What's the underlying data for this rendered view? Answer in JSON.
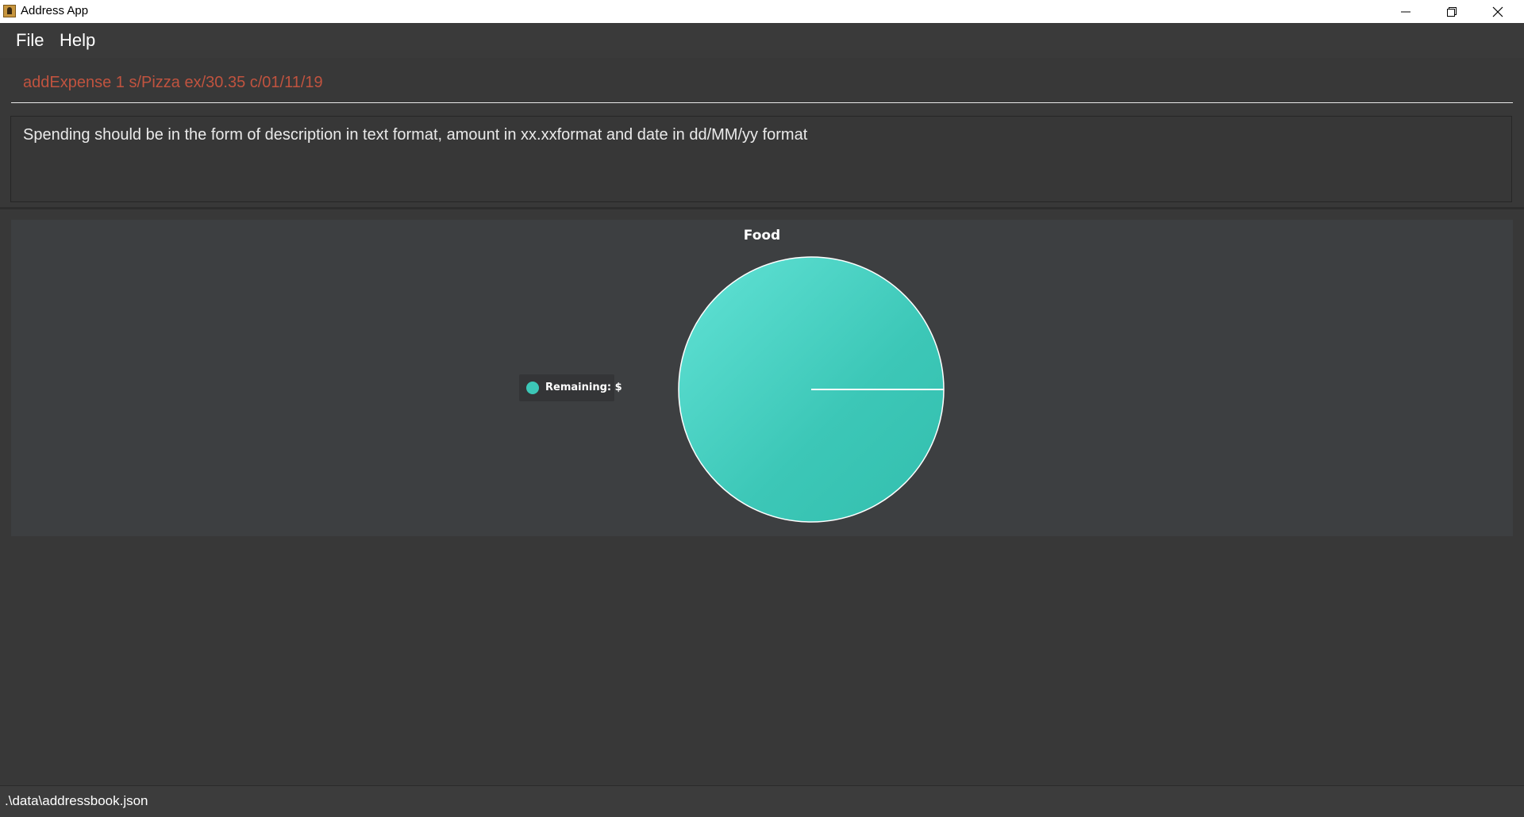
{
  "window": {
    "title": "Address App"
  },
  "menu": {
    "items": [
      {
        "label": "File"
      },
      {
        "label": "Help"
      }
    ]
  },
  "command": {
    "value": "addExpense 1 s/Pizza ex/30.35 c/01/11/19",
    "color": "#c0533f"
  },
  "result": {
    "message": "Spending should be in the form of description in text format, amount in xx.xxformat and date in dd/MM/yy format"
  },
  "chart_data": {
    "type": "pie",
    "title": "Food",
    "slices": [
      {
        "label": "Remaining: $",
        "value": 100,
        "color": "#3cc7b7"
      }
    ],
    "legend_position": "left"
  },
  "status": {
    "path": ".\\data\\addressbook.json"
  }
}
